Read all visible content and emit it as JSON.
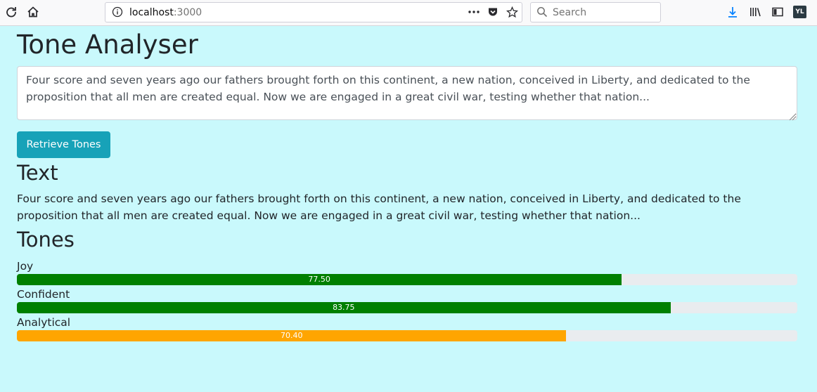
{
  "browser": {
    "url_host": "localhost",
    "url_port": ":3000",
    "search_placeholder": "Search",
    "profile_initials": "YL"
  },
  "page": {
    "title": "Tone Analyser",
    "input_text": "Four score and seven years ago our fathers brought forth on this continent, a new nation, conceived in Liberty, and dedicated to the proposition that all men are created equal. Now we are engaged in a great civil war, testing whether that nation...",
    "button_label": "Retrieve Tones",
    "text_heading": "Text",
    "body_text": "Four score and seven years ago our fathers brought forth on this continent, a new nation, conceived in Liberty, and dedicated to the proposition that all men are created equal. Now we are engaged in a great civil war, testing whether that nation...",
    "tones_heading": "Tones"
  },
  "tones": [
    {
      "name": "Joy",
      "score": 77.5,
      "display": "77.50",
      "color": "#008000"
    },
    {
      "name": "Confident",
      "score": 83.75,
      "display": "83.75",
      "color": "#008000"
    },
    {
      "name": "Analytical",
      "score": 70.4,
      "display": "70.40",
      "color": "#ffa500"
    }
  ],
  "colors": {
    "page_background": "#c9f9fc",
    "button": "#17a2b8",
    "track": "#e9ecef"
  }
}
